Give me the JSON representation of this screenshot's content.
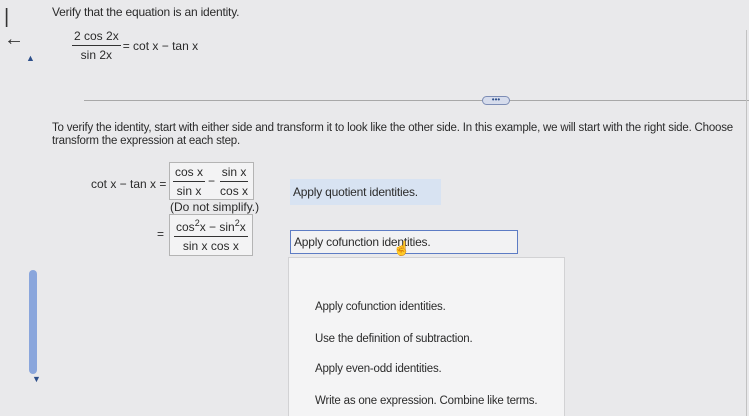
{
  "nav": {
    "back_label": "|←"
  },
  "question": {
    "title": "Verify that the equation is an identity.",
    "equation": {
      "numerator": "2 cos 2x",
      "denominator": "sin 2x",
      "right": "= cot x − tan x"
    }
  },
  "more_label": "•••",
  "instructions": {
    "line1": "To verify the identity, start with either side and transform it to look like the other side. In this example, we will start with the right side. Choose",
    "line2": "transform the expression at each step."
  },
  "steps": {
    "lhs": "cot x − tan x =",
    "step1": {
      "frac1_num": "cos x",
      "frac1_den": "sin x",
      "minus": "−",
      "frac2_num": "sin x",
      "frac2_den": "cos x",
      "reason": "Apply quotient identities.",
      "note": "(Do not simplify.)"
    },
    "step2": {
      "eq": "=",
      "num_a": "cos",
      "exp_a": "2",
      "num_b": "x − sin",
      "exp_b": "2",
      "num_c": "x",
      "den": "sin x cos x",
      "selected": "Apply cofunction identities."
    }
  },
  "dropdown": {
    "options": [
      "Apply cofunction identities.",
      "Use the definition of subtraction.",
      "Apply even-odd identities.",
      "Write as one expression. Combine like terms."
    ]
  }
}
